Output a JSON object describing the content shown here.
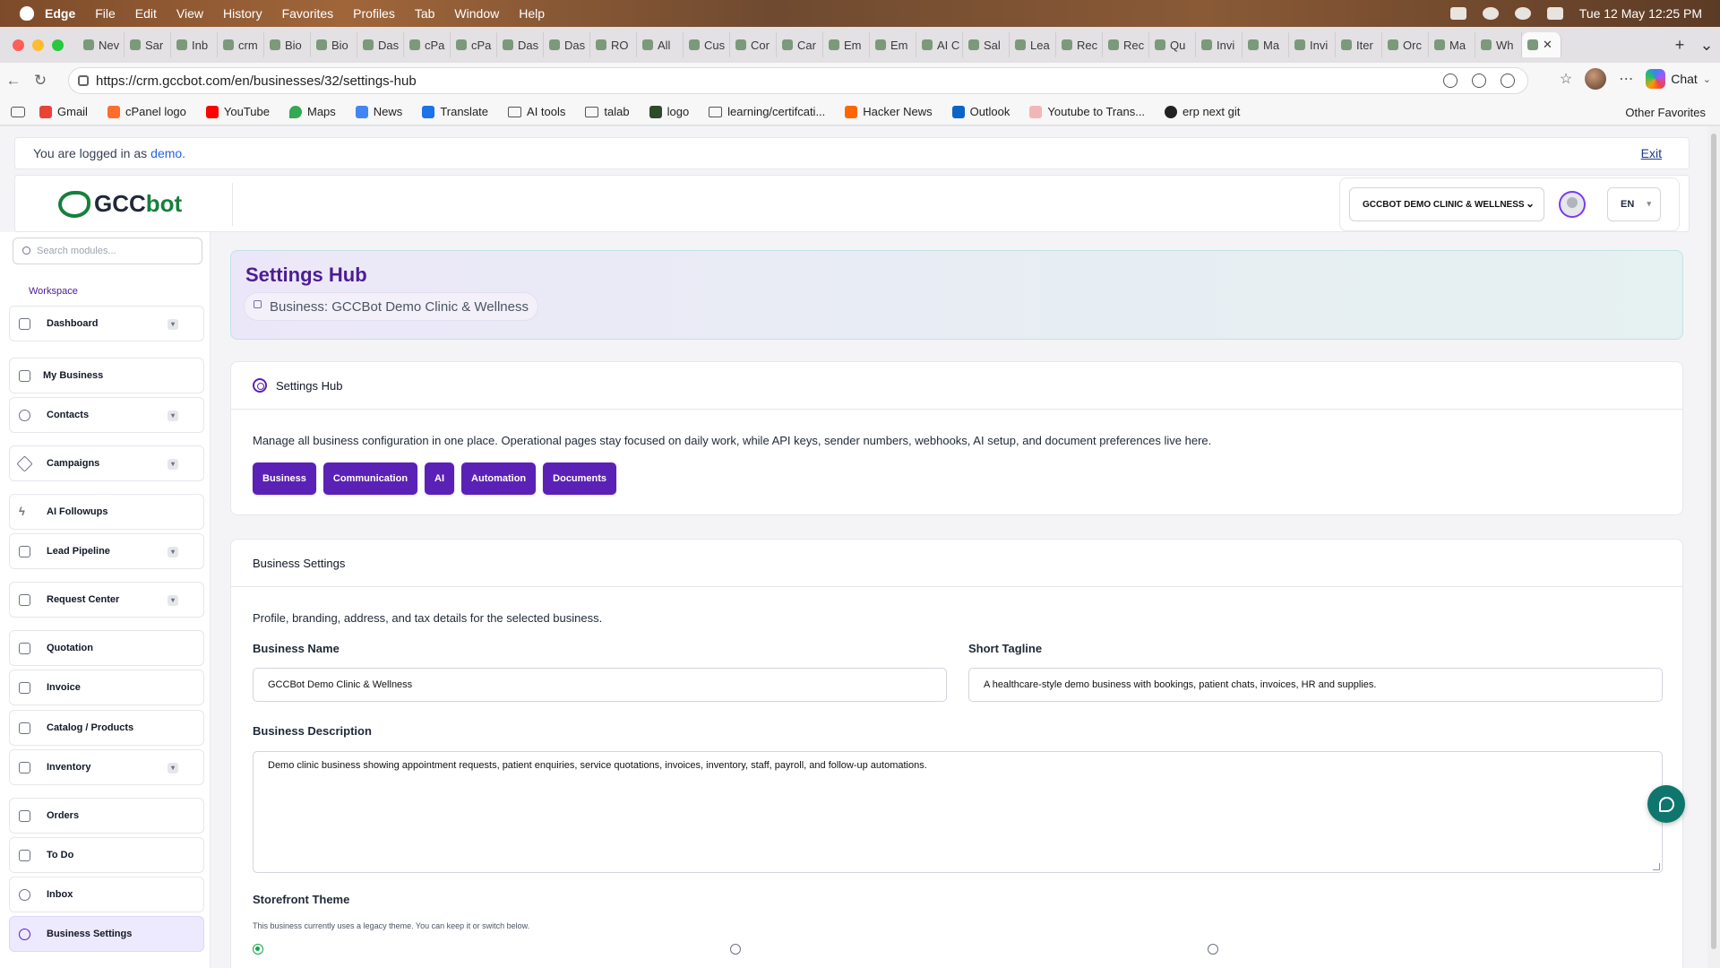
{
  "macos": {
    "menus": [
      "Edge",
      "File",
      "Edit",
      "View",
      "History",
      "Favorites",
      "Profiles",
      "Tab",
      "Window",
      "Help"
    ],
    "clock": "Tue 12 May  12:25 PM"
  },
  "tabs": [
    "Nev",
    "Sar",
    "Inb",
    "crm",
    "Bio",
    "Bio",
    "Das",
    "cPa",
    "cPa",
    "Das",
    "Das",
    "RO",
    "All",
    "Cus",
    "Cor",
    "Car",
    "Em",
    "Em",
    "AI C",
    "Sal",
    "Lea",
    "Rec",
    "Rec",
    "Qu",
    "Invi",
    "Ma",
    "Invi",
    "Iter",
    "Orc",
    "Ma",
    "Wh"
  ],
  "browser": {
    "url": "https://crm.gccbot.com/en/businesses/32/settings-hub",
    "chat_label": "Chat",
    "bookmarks": [
      "Gmail",
      "cPanel logo",
      "YouTube",
      "Maps",
      "News",
      "Translate",
      "AI tools",
      "talab",
      "logo",
      "learning/certifcati...",
      "Hacker News",
      "Outlook",
      "Youtube to Trans...",
      "erp next git"
    ],
    "other_favorites": "Other Favorites"
  },
  "login": {
    "prefix": "You are logged in as",
    "user": "demo.",
    "exit": "Exit"
  },
  "header": {
    "brand_gcc": "GCC",
    "brand_bot": "bot",
    "business_select": "GCCBOT DEMO CLINIC & WELLNESS",
    "language": "EN"
  },
  "sidebar": {
    "search_placeholder": "Search modules...",
    "section": "Workspace",
    "items": [
      {
        "label": "Dashboard"
      },
      {
        "label": "My Business"
      },
      {
        "label": "Contacts"
      },
      {
        "label": "Campaigns"
      },
      {
        "label": "AI Followups"
      },
      {
        "label": "Lead Pipeline"
      },
      {
        "label": "Request Center"
      },
      {
        "label": "Quotation"
      },
      {
        "label": "Invoice"
      },
      {
        "label": "Catalog / Products"
      },
      {
        "label": "Inventory"
      },
      {
        "label": "Orders"
      },
      {
        "label": "To Do"
      },
      {
        "label": "Inbox"
      },
      {
        "label": "Business Settings"
      }
    ]
  },
  "hub": {
    "title": "Settings Hub",
    "business_chip": "Business: GCCBot Demo Clinic & Wellness"
  },
  "hub_card": {
    "title": "Settings Hub",
    "description": "Manage all business configuration in one place. Operational pages stay focused on daily work, while API keys, sender numbers, webhooks, AI setup, and document preferences live here.",
    "tabs": [
      "Business",
      "Communication",
      "AI",
      "Automation",
      "Documents"
    ]
  },
  "business_settings": {
    "title": "Business Settings",
    "description": "Profile, branding, address, and tax details for the selected business.",
    "name_label": "Business Name",
    "name_value": "GCCBot Demo Clinic & Wellness",
    "tagline_label": "Short Tagline",
    "tagline_value": "A healthcare-style demo business with bookings, patient chats, invoices, HR and supplies.",
    "description_label": "Business Description",
    "description_value": "Demo clinic business showing appointment requests, patient enquiries, service quotations, invoices, inventory, staff, payroll, and follow-up automations.",
    "theme_label": "Storefront Theme",
    "theme_note": "This business currently uses a legacy theme. You can keep it or switch below."
  }
}
